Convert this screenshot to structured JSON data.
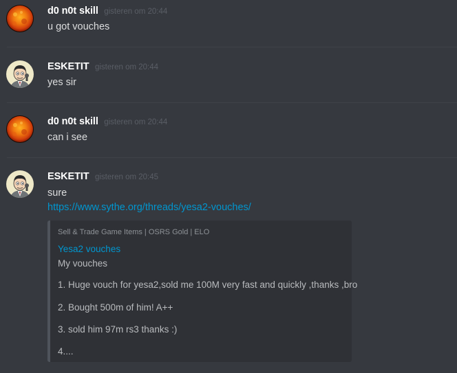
{
  "messages": [
    {
      "username": "d0 n0t skill",
      "timestamp": "gisteren om 20:44",
      "text": "u got vouches",
      "avatar": "sun-avatar-icon"
    },
    {
      "username": "ESKETIT",
      "timestamp": "gisteren om 20:44",
      "text": "yes sir",
      "avatar": "cartoon-man-avatar-icon"
    },
    {
      "username": "d0 n0t skill",
      "timestamp": "gisteren om 20:44",
      "text": "can i see",
      "avatar": "sun-avatar-icon"
    },
    {
      "username": "ESKETIT",
      "timestamp": "gisteren om 20:45",
      "text": "sure",
      "link": "https://www.sythe.org/threads/yesa2-vouches/",
      "avatar": "cartoon-man-avatar-icon"
    }
  ],
  "embed": {
    "provider": "Sell & Trade Game Items | OSRS Gold | ELO",
    "title": "Yesa2 vouches",
    "lines": [
      "My vouches",
      "1. Huge vouch for yesa2,sold me 100M very fast and quickly ,thanks ,bro",
      "2. Bought 500m of him! A++",
      "3. sold him 97m rs3 thanks :)",
      "4...."
    ]
  },
  "colors": {
    "background": "#36393f",
    "embed_background": "#2f3136",
    "embed_border": "#4f545c",
    "link": "#0096cf",
    "username": "#ffffff",
    "timestamp": "#5a5e66"
  }
}
